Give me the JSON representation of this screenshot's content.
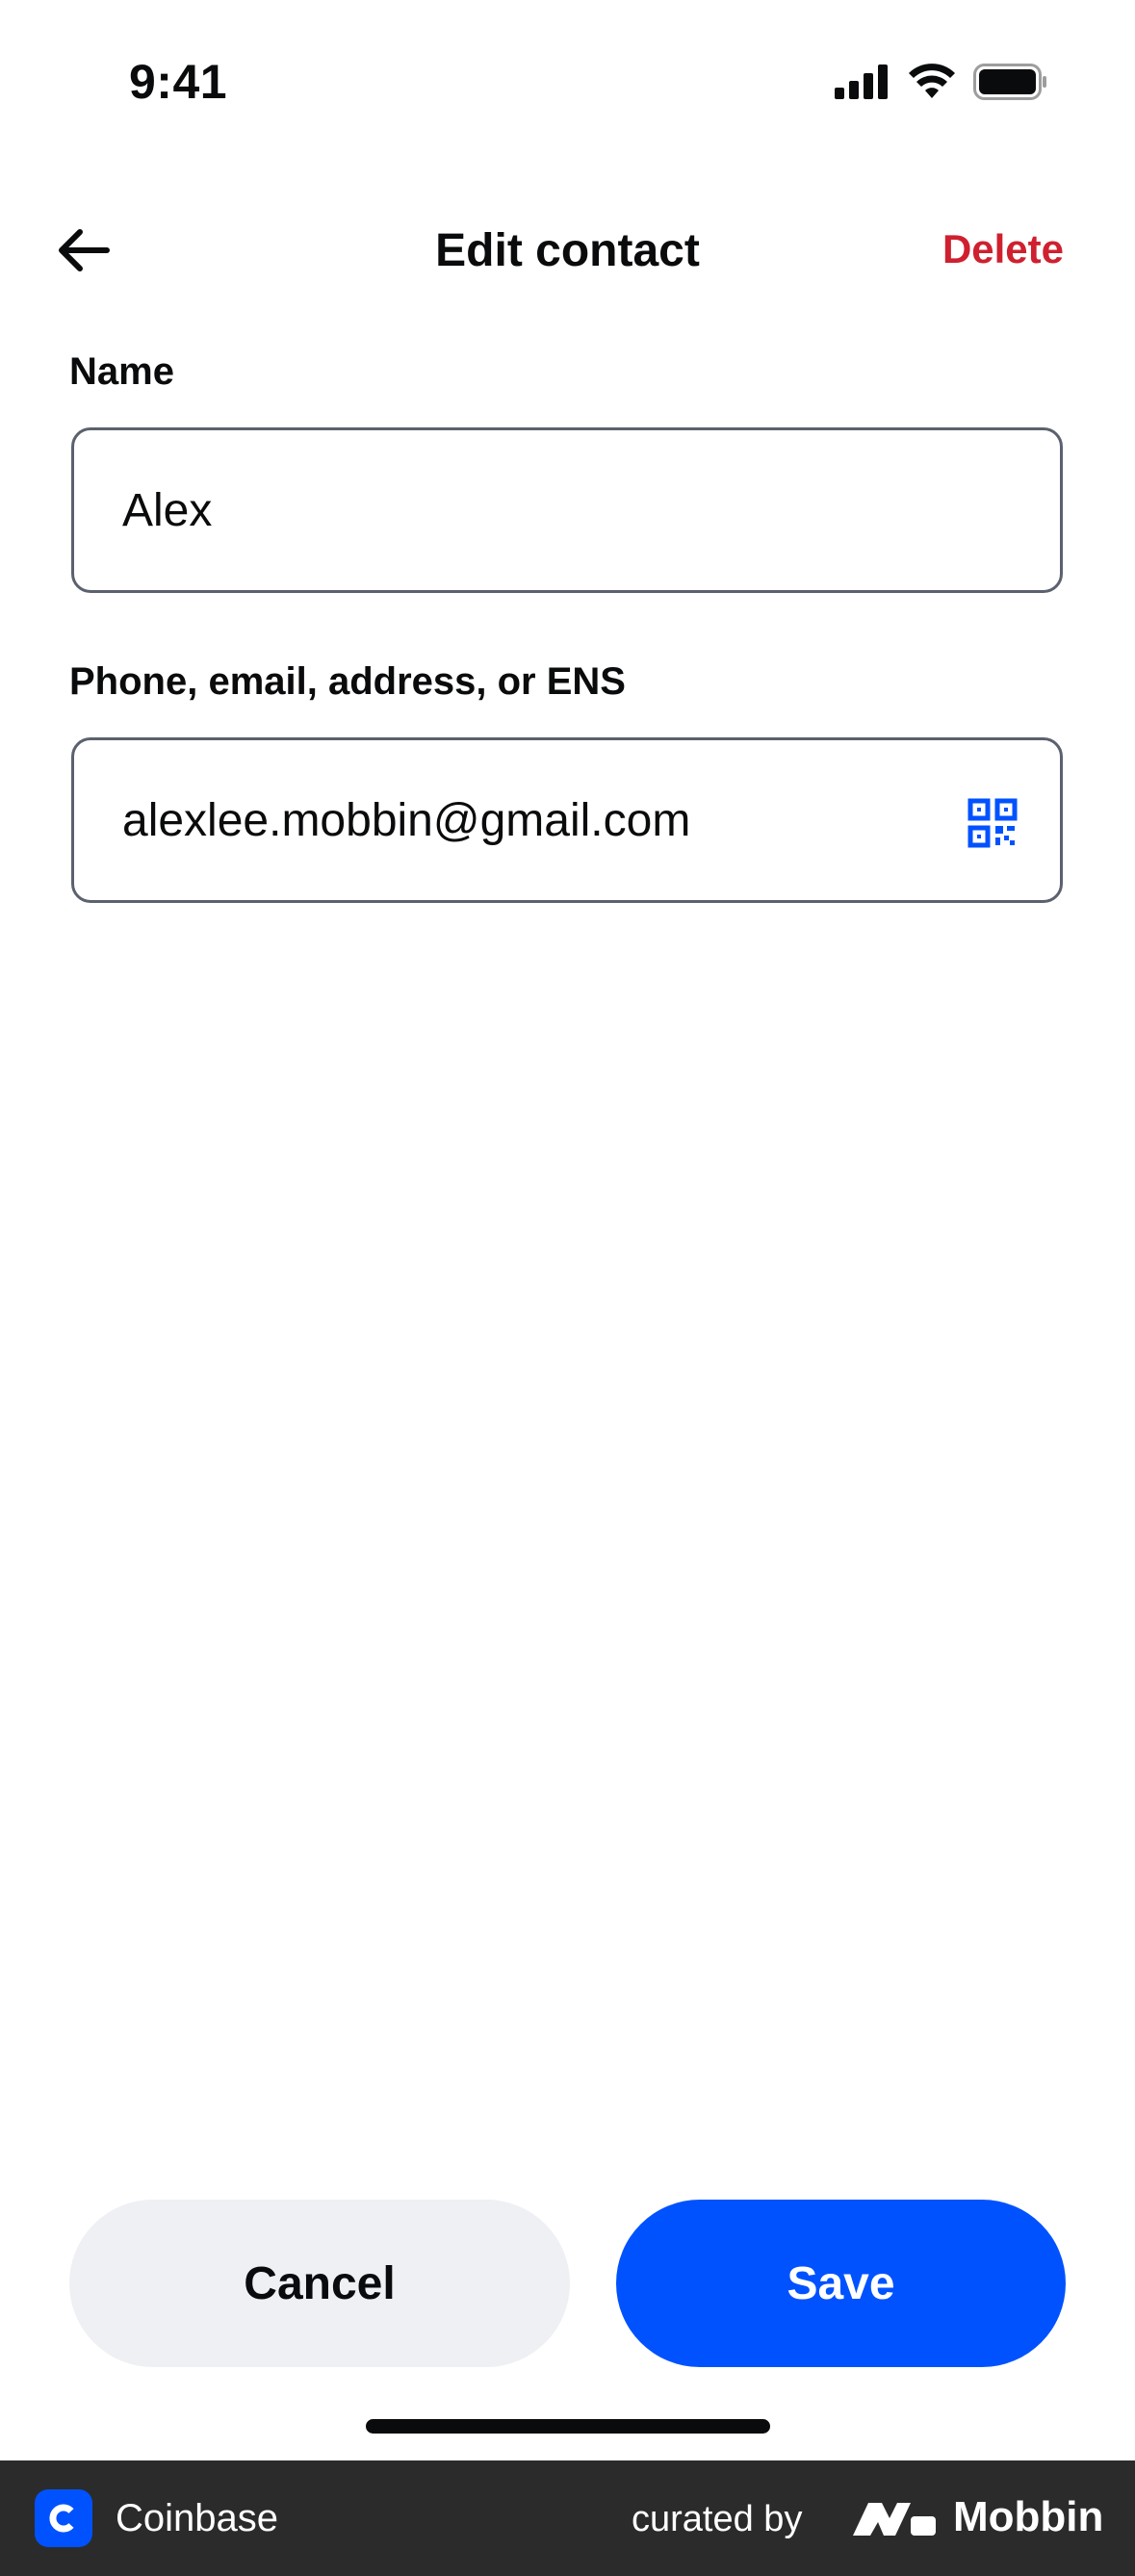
{
  "status_bar": {
    "time": "9:41"
  },
  "header": {
    "title": "Edit contact",
    "delete_label": "Delete"
  },
  "form": {
    "name_label": "Name",
    "name_value": "Alex",
    "address_label": "Phone, email, address, or ENS",
    "address_value": "alexlee.mobbin@gmail.com"
  },
  "actions": {
    "cancel_label": "Cancel",
    "save_label": "Save"
  },
  "footer": {
    "app_name": "Coinbase",
    "curated_by": "curated by",
    "brand": "Mobbin"
  },
  "colors": {
    "accent": "#0052ff",
    "danger": "#cf202f",
    "secondary_button": "#eef0f3"
  },
  "icons": [
    "back-arrow-icon",
    "qr-code-icon",
    "signal-icon",
    "wifi-icon",
    "battery-icon",
    "coinbase-logo-icon",
    "mobbin-logo-icon"
  ]
}
